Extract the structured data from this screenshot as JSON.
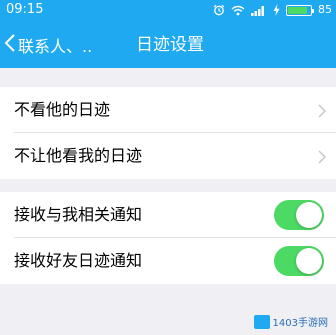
{
  "status_bar": {
    "time": "09:15",
    "battery_percent": "85",
    "battery_level": 0.85,
    "colors": {
      "battery_fill": "#4cd964"
    },
    "icons": [
      "alarm-icon",
      "wifi-icon",
      "signal-icon",
      "charging-icon",
      "battery-icon"
    ]
  },
  "nav": {
    "back_label": "联系人、..",
    "title": "日迹设置",
    "background": "#1fa9f0"
  },
  "settings": {
    "group_1": [
      {
        "label": "不看他的日迹",
        "control": "chevron-right-icon"
      },
      {
        "label": "不让他看我的日迹",
        "control": "chevron-right-icon"
      }
    ],
    "group_2": [
      {
        "label": "接收与我相关通知",
        "control": "toggle",
        "on": true
      },
      {
        "label": "接收好友日迹通知",
        "control": "toggle",
        "on": true
      }
    ],
    "toggle_on_color": "#4cd964"
  },
  "watermark": {
    "text": "1403手游网"
  }
}
